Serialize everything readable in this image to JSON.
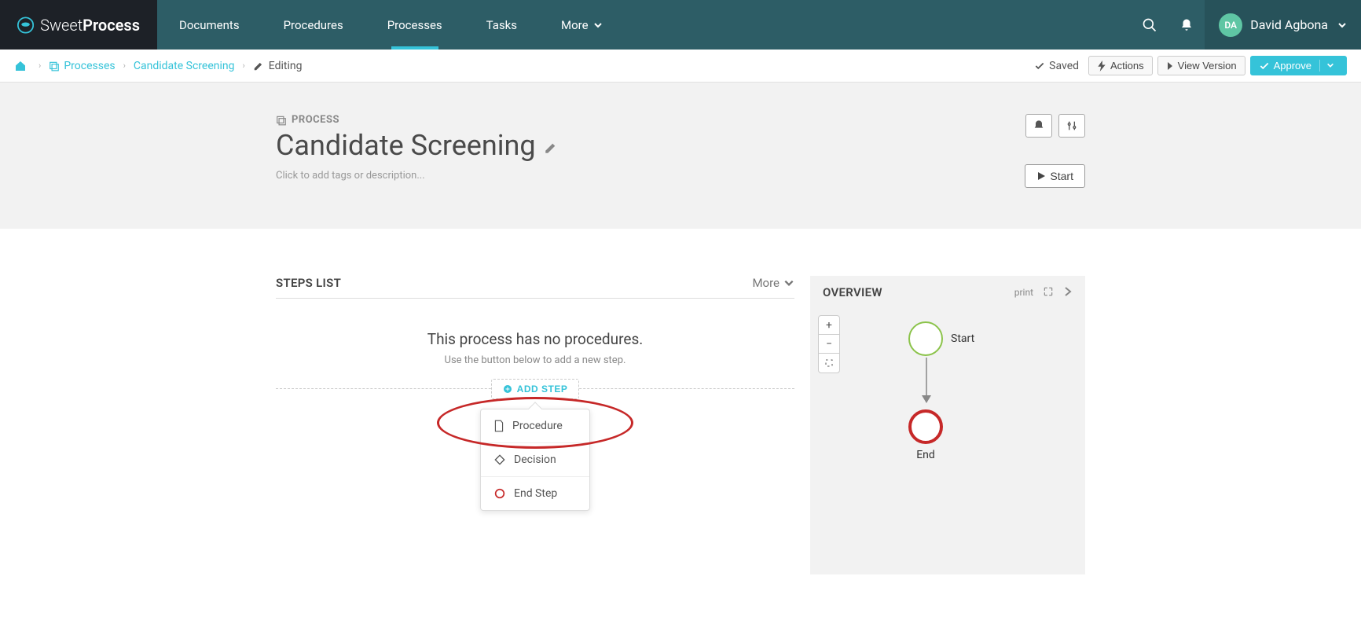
{
  "logo": {
    "brand1": "Sweet",
    "brand2": "Process"
  },
  "nav": {
    "items": [
      "Documents",
      "Procedures",
      "Processes",
      "Tasks",
      "More"
    ],
    "active_index": 2
  },
  "user": {
    "initials": "DA",
    "name": "David Agbona"
  },
  "breadcrumb": {
    "processes": "Processes",
    "process_name": "Candidate Screening",
    "editing": "Editing"
  },
  "toolbar": {
    "saved": "Saved",
    "actions": "Actions",
    "view_version": "View Version",
    "approve": "Approve"
  },
  "header": {
    "label": "PROCESS",
    "title": "Candidate Screening",
    "tags_placeholder": "Click to add tags or description...",
    "start": "Start"
  },
  "steps": {
    "title": "STEPS LIST",
    "more": "More",
    "empty_heading": "This process has no procedures.",
    "empty_sub": "Use the button below to add a new step.",
    "add_step": "ADD STEP",
    "menu": {
      "procedure": "Procedure",
      "decision": "Decision",
      "end_step": "End Step"
    }
  },
  "overview": {
    "title": "OVERVIEW",
    "print": "print",
    "start_node": "Start",
    "end_node": "End"
  }
}
